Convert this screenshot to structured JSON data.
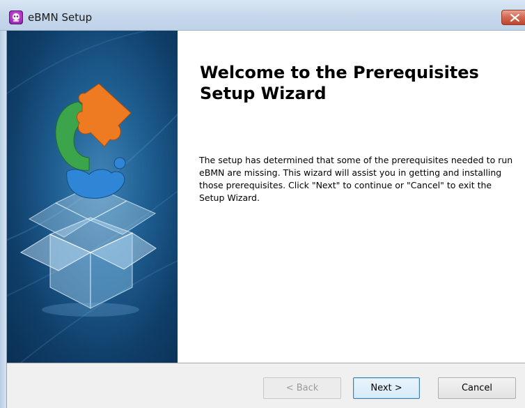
{
  "window": {
    "title": "eBMN Setup",
    "icons": {
      "app": "app-logo-icon",
      "close": "close-icon"
    }
  },
  "wizard": {
    "heading": "Welcome to the Prerequisites Setup Wizard",
    "body": "The setup has determined that some of the prerequisites needed to run eBMN are missing. This wizard will assist you in getting and installing those prerequisites. Click \"Next\" to continue or \"Cancel\" to exit the Setup Wizard.",
    "graphic": "puzzle-box-illustration"
  },
  "buttons": {
    "back": "< Back",
    "next": "Next >",
    "cancel": "Cancel",
    "back_enabled": false
  },
  "colors": {
    "titlebar": "#c4d6ea",
    "side_panel": "#1f5f92",
    "close": "#c0442c",
    "puzzle_orange": "#ee7a22",
    "puzzle_green": "#3ca54b",
    "puzzle_blue": "#2f86d6",
    "default_button_border": "#3c7fb1"
  }
}
